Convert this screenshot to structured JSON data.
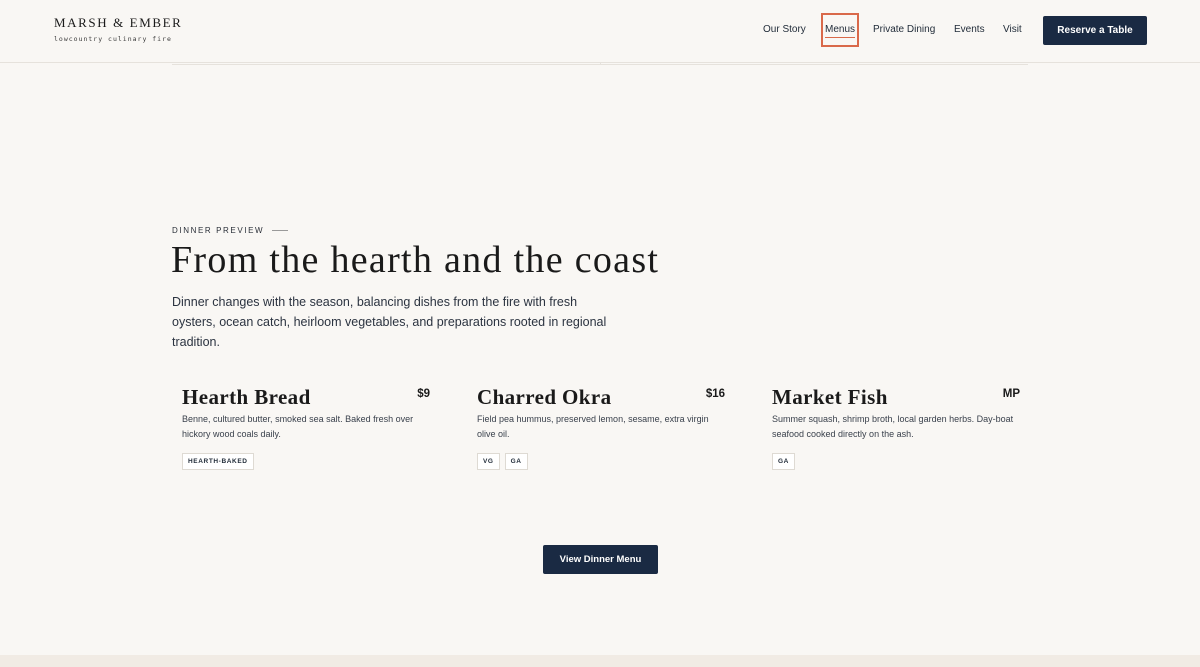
{
  "brand": {
    "name": "MARSH & EMBER",
    "tagline": "lowcountry culinary fire"
  },
  "nav": {
    "items": [
      {
        "label": "Our Story"
      },
      {
        "label": "Menus",
        "active": true
      },
      {
        "label": "Private Dining"
      },
      {
        "label": "Events"
      },
      {
        "label": "Visit"
      }
    ],
    "reserve_label": "Reserve a Table"
  },
  "section": {
    "eyebrow": "DINNER PREVIEW",
    "title": "From the hearth and the coast",
    "intro": "Dinner changes with the season, balancing dishes from the fire with fresh oysters, ocean catch, heirloom vegetables, and preparations rooted in regional tradition."
  },
  "menu_items": [
    {
      "name": "Hearth Bread",
      "price": "$9",
      "description": "Benne, cultured butter, smoked sea salt. Baked fresh over hickory wood coals daily.",
      "tags": [
        "HEARTH-BAKED"
      ]
    },
    {
      "name": "Charred Okra",
      "price": "$16",
      "description": "Field pea hummus, preserved lemon, sesame, extra virgin olive oil.",
      "tags": [
        "VG",
        "GA"
      ]
    },
    {
      "name": "Market Fish",
      "price": "MP",
      "description": "Summer squash, shrimp broth, local garden herbs. Day-boat seafood cooked directly on the ash.",
      "tags": [
        "GA"
      ]
    }
  ],
  "cta_label": "View Dinner Menu",
  "colors": {
    "background": "#f9f7f4",
    "navy": "#1a2a43",
    "accent": "#d9694a"
  }
}
